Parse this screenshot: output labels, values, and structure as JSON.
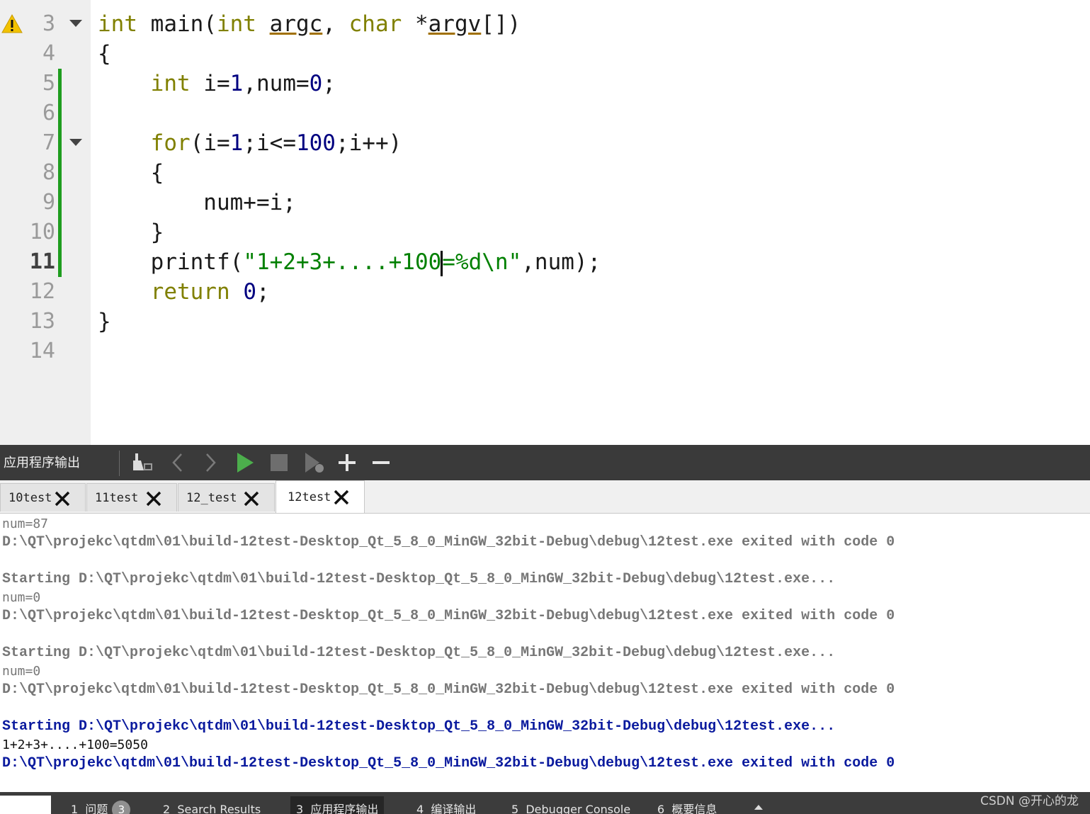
{
  "editor": {
    "line_numbers": [
      "3",
      "4",
      "5",
      "6",
      "7",
      "8",
      "9",
      "10",
      "11",
      "12",
      "13",
      "14"
    ],
    "current_line": "11",
    "warning_line": "3",
    "fold_lines": [
      "3",
      "7"
    ],
    "modified_lines": [
      "5",
      "6",
      "7",
      "8",
      "9",
      "10",
      "11"
    ],
    "code_lines": [
      "int main(int argc, char *argv[])",
      "{",
      "    int i=1,num=0;",
      "",
      "    for(i=1;i<=100;i++)",
      "    {",
      "        num+=i;",
      "    }",
      "    printf(\"1+2+3+....+100=%d\\n\",num);",
      "    return 0;",
      "}",
      ""
    ]
  },
  "output_pane": {
    "title": "应用程序输出",
    "toolbar_icons": [
      "clean-icon",
      "back-icon",
      "forward-icon",
      "run-icon",
      "stop-icon",
      "attach-debugger-icon",
      "zoom-in-icon",
      "zoom-out-icon"
    ],
    "tabs": [
      {
        "label": "10test",
        "active": false
      },
      {
        "label": "11test",
        "active": false
      },
      {
        "label": "12_test",
        "active": false
      },
      {
        "label": "12test",
        "active": true
      }
    ],
    "lines": [
      {
        "text": "num=87",
        "style": "plain"
      },
      {
        "text": "D:\\QT\\projekc\\qtdm\\01\\build-12test-Desktop_Qt_5_8_0_MinGW_32bit-Debug\\debug\\12test.exe exited with code 0",
        "style": "bold"
      },
      {
        "text": "",
        "style": "plain"
      },
      {
        "text": "Starting D:\\QT\\projekc\\qtdm\\01\\build-12test-Desktop_Qt_5_8_0_MinGW_32bit-Debug\\debug\\12test.exe...",
        "style": "bold"
      },
      {
        "text": "num=0",
        "style": "plain"
      },
      {
        "text": "D:\\QT\\projekc\\qtdm\\01\\build-12test-Desktop_Qt_5_8_0_MinGW_32bit-Debug\\debug\\12test.exe exited with code 0",
        "style": "bold"
      },
      {
        "text": "",
        "style": "plain"
      },
      {
        "text": "Starting D:\\QT\\projekc\\qtdm\\01\\build-12test-Desktop_Qt_5_8_0_MinGW_32bit-Debug\\debug\\12test.exe...",
        "style": "bold"
      },
      {
        "text": "num=0",
        "style": "plain"
      },
      {
        "text": "D:\\QT\\projekc\\qtdm\\01\\build-12test-Desktop_Qt_5_8_0_MinGW_32bit-Debug\\debug\\12test.exe exited with code 0",
        "style": "bold"
      },
      {
        "text": "",
        "style": "plain"
      },
      {
        "text": "Starting D:\\QT\\projekc\\qtdm\\01\\build-12test-Desktop_Qt_5_8_0_MinGW_32bit-Debug\\debug\\12test.exe...",
        "style": "bold-blue"
      },
      {
        "text": "1+2+3+....+100=5050",
        "style": "plain-dark"
      },
      {
        "text": "D:\\QT\\projekc\\qtdm\\01\\build-12test-Desktop_Qt_5_8_0_MinGW_32bit-Debug\\debug\\12test.exe exited with code 0",
        "style": "bold-blue"
      }
    ]
  },
  "bottom_bar": {
    "items": [
      {
        "number": "1",
        "label": "问题",
        "badge": "3",
        "active": false
      },
      {
        "number": "2",
        "label": "Search Results",
        "active": false
      },
      {
        "number": "3",
        "label": "应用程序输出",
        "active": true
      },
      {
        "number": "4",
        "label": "编译输出",
        "active": false
      },
      {
        "number": "5",
        "label": "Debugger Console",
        "active": false
      },
      {
        "number": "6",
        "label": "概要信息",
        "active": false
      }
    ],
    "watermark": "CSDN @开心的龙"
  },
  "colors": {
    "keyword": "#808000",
    "number": "#000080",
    "string": "#008000",
    "modified_marker": "#1f9d1f",
    "output_blue": "#0a1a9e"
  }
}
